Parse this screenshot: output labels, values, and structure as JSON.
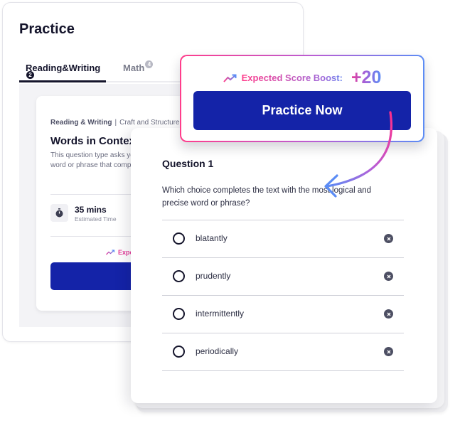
{
  "practice_panel": {
    "title": "Practice",
    "tabs": [
      {
        "label": "Reading&Writing",
        "count": "2",
        "active": true
      },
      {
        "label": "Math",
        "count": "4",
        "active": false
      }
    ],
    "lesson": {
      "category": "Reading & Writing",
      "separator": "|",
      "subcategory": "Craft and Structure",
      "title": "Words in Context",
      "description": "This question type asks you to choose the most logical and precise word or phrase that completes the text in a given passage.",
      "time_value": "35 mins",
      "time_label": "Estimated Time",
      "boost_label_truncated": "Expected Score Boost"
    }
  },
  "boost_popup": {
    "label": "Expected Score Boost:",
    "value": "+20",
    "button_label": "Practice Now",
    "icon": "trending-up-icon"
  },
  "question": {
    "title": "Question 1",
    "prompt": "Which choice completes the text with the most logical and precise word or phrase?",
    "options": [
      {
        "label": "blatantly"
      },
      {
        "label": "prudently"
      },
      {
        "label": "intermittently"
      },
      {
        "label": "periodically"
      }
    ]
  },
  "colors": {
    "primary": "#1423a8",
    "gradient_start": "#ff3d8b",
    "gradient_end": "#5b8cf5",
    "text_dark": "#14142b"
  }
}
